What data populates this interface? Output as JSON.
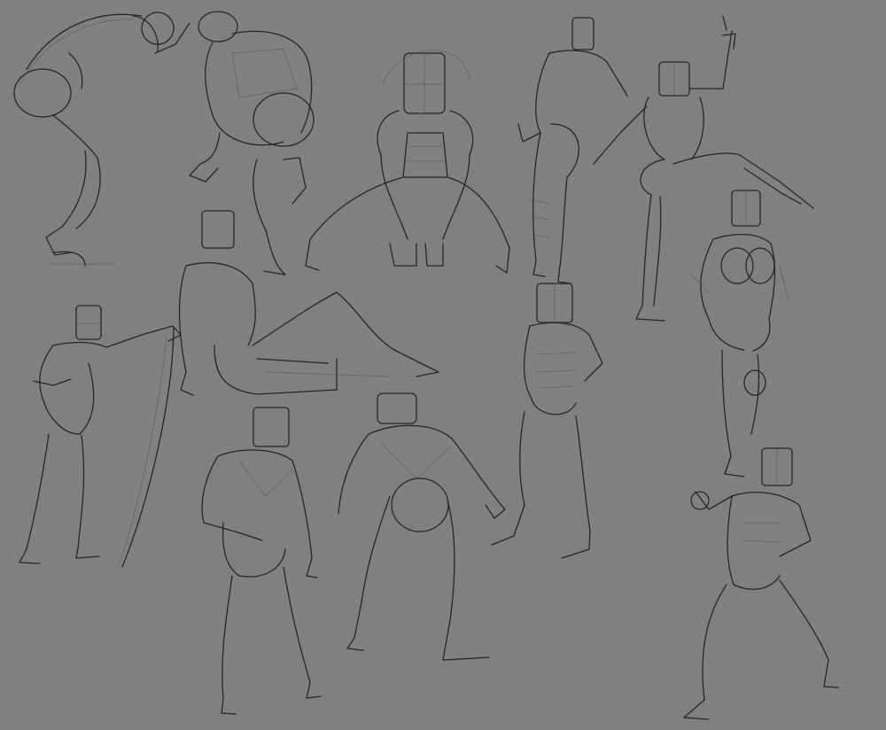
{
  "colors": {
    "background": "#808080",
    "ink": "#262626",
    "construction": "#4a4a4a"
  },
  "figures": [
    {
      "name": "bent-over-figure"
    },
    {
      "name": "crouching-back-figure"
    },
    {
      "name": "wide-squat-figure"
    },
    {
      "name": "standing-back-figure"
    },
    {
      "name": "high-kick-figure"
    },
    {
      "name": "standing-female-figure"
    },
    {
      "name": "figure-holding-staff"
    },
    {
      "name": "reclining-figure"
    },
    {
      "name": "hand-on-hip-figure"
    },
    {
      "name": "walking-back-figure"
    },
    {
      "name": "crouched-back-stance-figure"
    },
    {
      "name": "fighting-stance-figure"
    }
  ]
}
